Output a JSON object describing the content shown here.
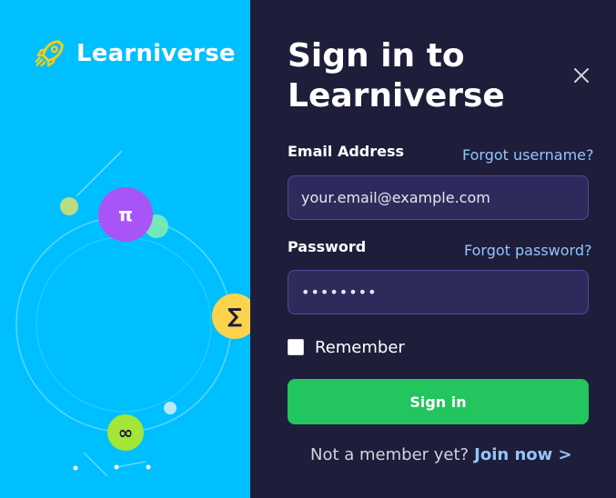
{
  "brand": {
    "name": "Learniverse",
    "icon": "rocket-icon"
  },
  "illustration": {
    "badges": {
      "pi": "π",
      "sigma": "∑",
      "infinity": "∞"
    }
  },
  "dialog": {
    "title_line1": "Sign in to",
    "title_line2": "Learniverse",
    "close_icon": "close-icon"
  },
  "form": {
    "email_label": "Email Address",
    "forgot_username": "Forgot username?",
    "email_value": "your.email@example.com",
    "password_label": "Password",
    "forgot_password": "Forgot password?",
    "password_value": "••••••••",
    "remember_label": "Remember",
    "remember_checked": false,
    "signin_label": "Sign in"
  },
  "footer": {
    "prompt": "Not a member yet?",
    "join_link": "Join now >"
  },
  "colors": {
    "left_bg": "#00bfff",
    "right_bg": "#1e1d3a",
    "primary_button": "#22c55e",
    "link": "#93c5fd",
    "input_bg": "#2e2b5c"
  }
}
